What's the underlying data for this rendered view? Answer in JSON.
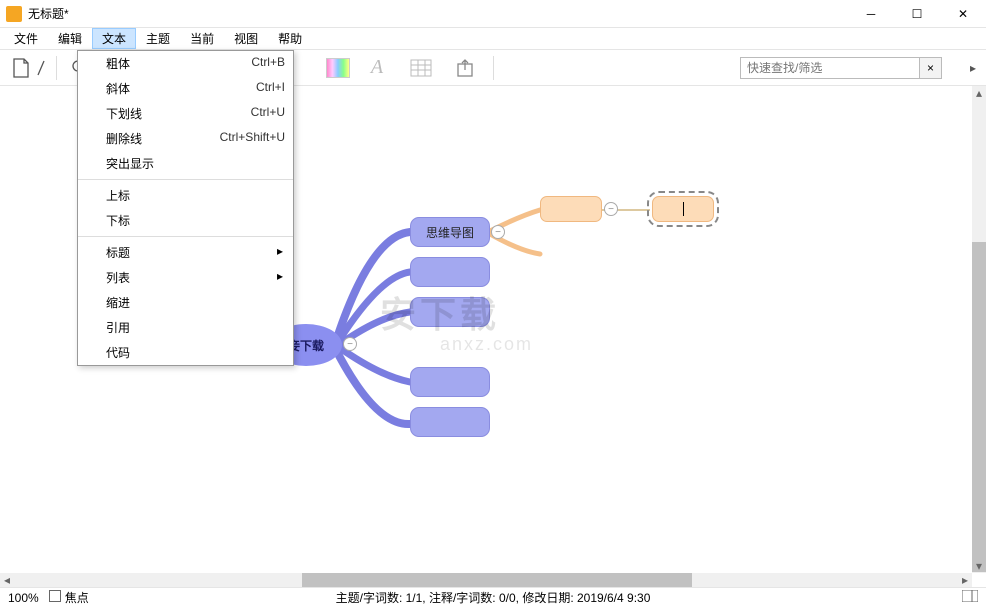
{
  "window": {
    "title": "无标题*"
  },
  "menubar": {
    "items": [
      "文件",
      "编辑",
      "文本",
      "主题",
      "当前",
      "视图",
      "帮助"
    ],
    "active_index": 2
  },
  "dropdown": {
    "items": [
      {
        "label": "粗体",
        "shortcut": "Ctrl+B"
      },
      {
        "label": "斜体",
        "shortcut": "Ctrl+I"
      },
      {
        "label": "下划线",
        "shortcut": "Ctrl+U"
      },
      {
        "label": "删除线",
        "shortcut": "Ctrl+Shift+U"
      },
      {
        "label": "突出显示",
        "shortcut": ""
      }
    ],
    "items2": [
      {
        "label": "上标",
        "shortcut": ""
      },
      {
        "label": "下标",
        "shortcut": ""
      }
    ],
    "items3": [
      {
        "label": "标题",
        "submenu": true
      },
      {
        "label": "列表",
        "submenu": true
      },
      {
        "label": "缩进",
        "shortcut": ""
      },
      {
        "label": "引用",
        "shortcut": ""
      },
      {
        "label": "代码",
        "shortcut": ""
      }
    ]
  },
  "search": {
    "placeholder": "快速查找/筛选",
    "clear": "×"
  },
  "mindmap": {
    "root": "妾下载",
    "child1": "思维导图",
    "grand_editing": ""
  },
  "statusbar": {
    "zoom": "100%",
    "focus": "焦点",
    "center": "主题/字词数: 1/1, 注释/字词数: 0/0, 修改日期:  2019/6/4 9:30"
  },
  "watermark": {
    "main": "安下载",
    "sub": "anxz.com"
  }
}
